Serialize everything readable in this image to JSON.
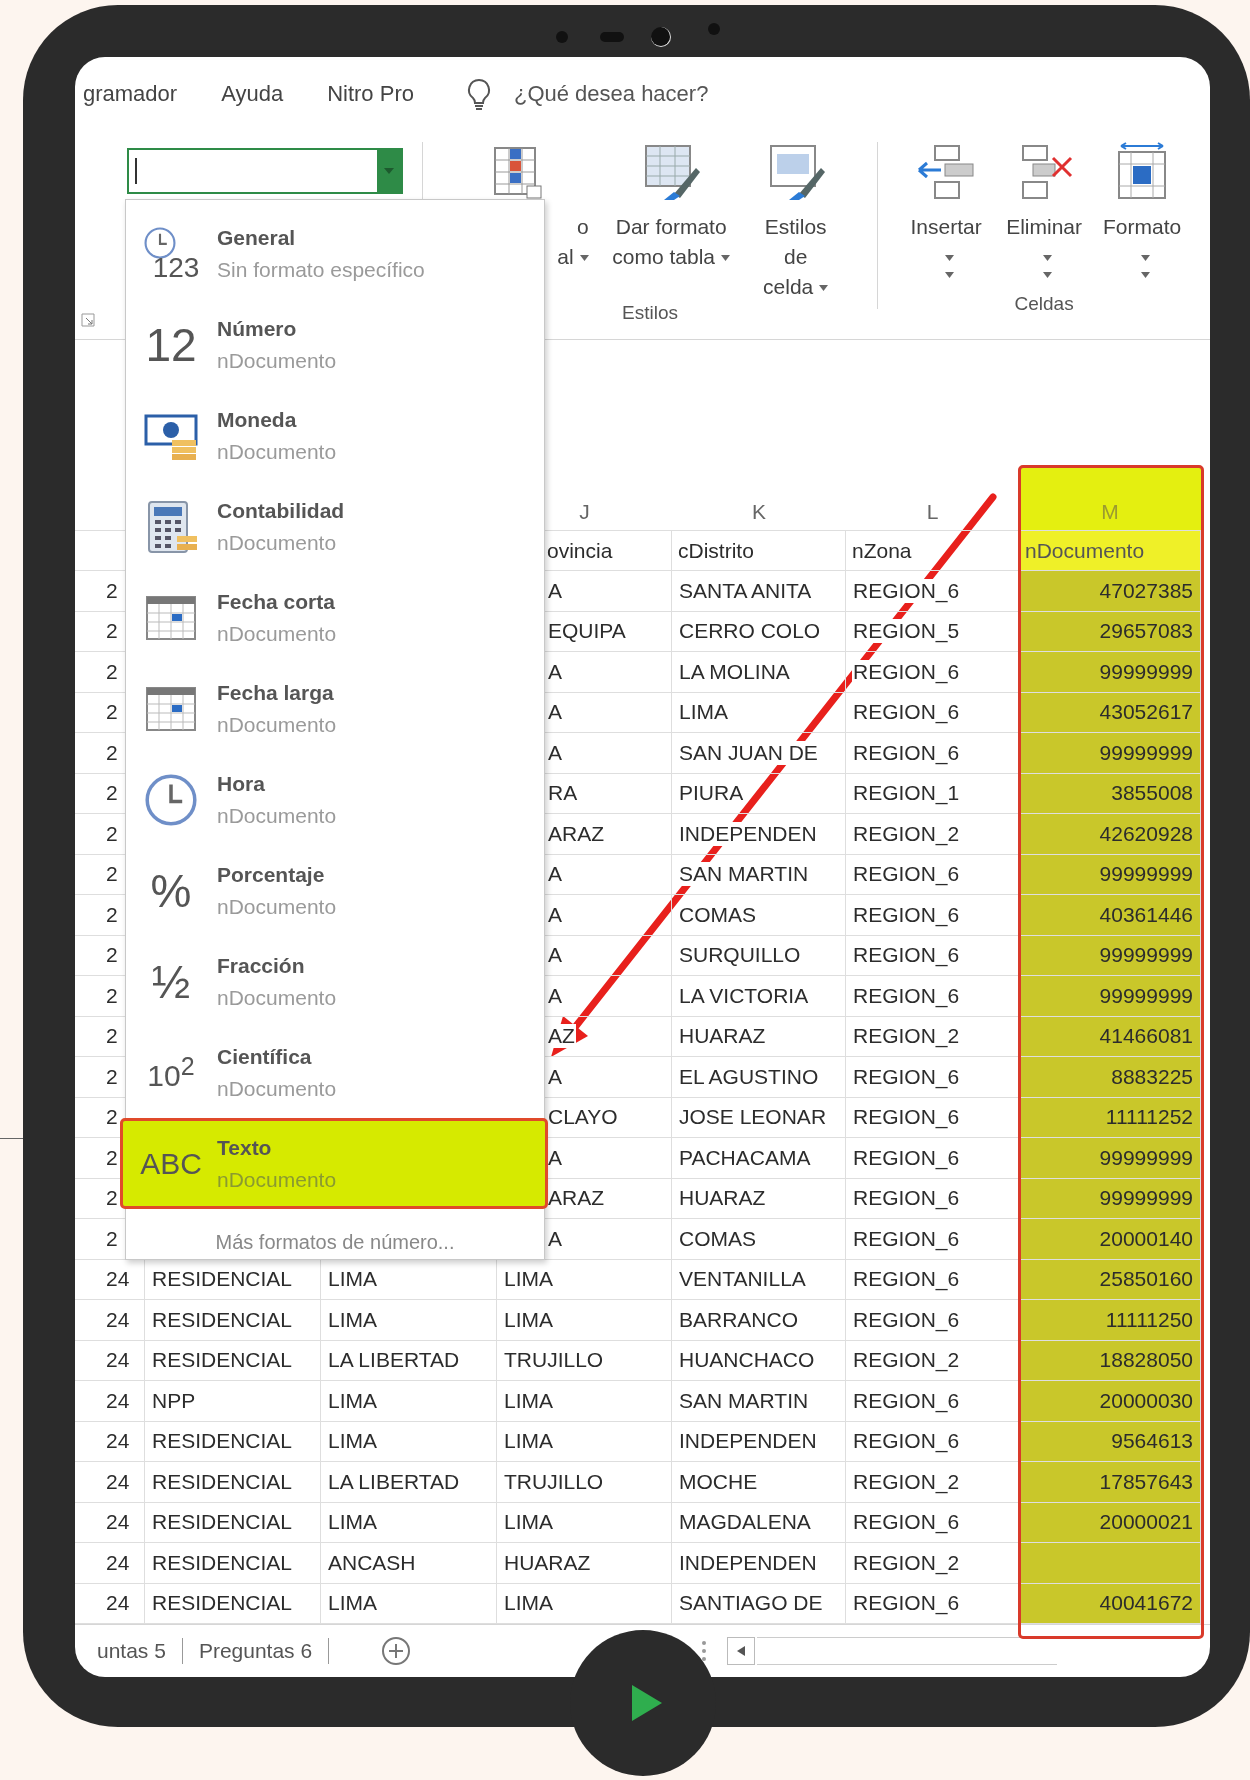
{
  "menu_bar": {
    "items": [
      "gramador",
      "Ayuda",
      "Nitro Pro"
    ],
    "search": {
      "placeholder": "¿Qué desea hacer?"
    }
  },
  "ribbon": {
    "number_format_box": {
      "expanded": true
    },
    "groups": [
      {
        "label": "Estilos",
        "buttons": [
          {
            "kind": "conditional",
            "lines": [
              "o",
              "al"
            ],
            "menu": true
          },
          {
            "kind": "table",
            "lines": [
              "Dar formato",
              "como tabla"
            ],
            "menu": true
          },
          {
            "kind": "cellstyle",
            "lines": [
              "Estilos de",
              "celda"
            ],
            "menu": true
          }
        ]
      },
      {
        "label": "Celdas",
        "buttons": [
          {
            "kind": "insert",
            "lines": [
              "Insertar"
            ],
            "menu": true
          },
          {
            "kind": "delete",
            "lines": [
              "Eliminar"
            ],
            "menu": true
          },
          {
            "kind": "format",
            "lines": [
              "Formato"
            ],
            "menu": true
          }
        ]
      }
    ]
  },
  "number_formats": {
    "items": [
      {
        "title": "General",
        "subtitle": "Sin formato específico",
        "icon": {
          "kind": "clock",
          "glyph": "123"
        },
        "selected": false
      },
      {
        "title": "Número",
        "subtitle": "nDocumento",
        "icon": {
          "kind": "glyph",
          "glyph": "12"
        },
        "selected": false
      },
      {
        "title": "Moneda",
        "subtitle": "nDocumento",
        "icon": {
          "kind": "money"
        },
        "selected": false
      },
      {
        "title": "Contabilidad",
        "subtitle": "nDocumento",
        "icon": {
          "kind": "calculator"
        },
        "selected": false
      },
      {
        "title": "Fecha corta",
        "subtitle": "nDocumento",
        "icon": {
          "kind": "calendar"
        },
        "selected": false
      },
      {
        "title": "Fecha larga",
        "subtitle": "nDocumento",
        "icon": {
          "kind": "calendar"
        },
        "selected": false
      },
      {
        "title": "Hora",
        "subtitle": "nDocumento",
        "icon": {
          "kind": "clock"
        },
        "selected": false
      },
      {
        "title": "Porcentaje",
        "subtitle": "nDocumento",
        "icon": {
          "kind": "glyph",
          "glyph": "%"
        },
        "selected": false
      },
      {
        "title": "Fracción",
        "subtitle": "nDocumento",
        "icon": {
          "kind": "glyph",
          "glyph": "½"
        },
        "selected": false
      },
      {
        "title": "Científica",
        "subtitle": "nDocumento",
        "icon": {
          "kind": "glyph",
          "glyph": "10$^{2}$"
        },
        "selected": false
      },
      {
        "title": "Texto",
        "subtitle": "nDocumento",
        "icon": {
          "kind": "glyph",
          "glyph": "ABC"
        },
        "selected": true
      }
    ],
    "more_link": "Más formatos de número..."
  },
  "sheet": {
    "columns": [
      {
        "letter": "J",
        "name": "ovincia",
        "selected": false
      },
      {
        "letter": "K",
        "name": "cDistrito",
        "selected": false
      },
      {
        "letter": "L",
        "name": "nZona",
        "selected": false
      },
      {
        "letter": "M",
        "name": "nDocumento",
        "selected": true
      }
    ],
    "rows": [
      {
        "column_1": "2",
        "j": "A",
        "k": "SANTA ANITA",
        "l": "REGION_6",
        "m": "47027385"
      },
      {
        "column_1": "2",
        "j": "EQUIPA",
        "k": "CERRO COLO",
        "l": "REGION_5",
        "m": "29657083"
      },
      {
        "column_1": "2",
        "j": "A",
        "k": "LA MOLINA",
        "l": "REGION_6",
        "m": "99999999"
      },
      {
        "column_1": "2",
        "j": "A",
        "k": "LIMA",
        "l": "REGION_6",
        "m": "43052617"
      },
      {
        "column_1": "2",
        "j": "A",
        "k": "SAN JUAN DE",
        "l": "REGION_6",
        "m": "99999999"
      },
      {
        "column_1": "2",
        "j": "RA",
        "k": "PIURA",
        "l": "REGION_1",
        "m": "3855008"
      },
      {
        "column_1": "2",
        "j": "ARAZ",
        "k": "INDEPENDEN",
        "l": "REGION_2",
        "m": "42620928"
      },
      {
        "column_1": "2",
        "j": "A",
        "k": "SAN MARTIN",
        "l": "REGION_6",
        "m": "99999999"
      },
      {
        "column_1": "2",
        "j": "A",
        "k": "COMAS",
        "l": "REGION_6",
        "m": "40361446"
      },
      {
        "column_1": "2",
        "j": "A",
        "k": "SURQUILLO",
        "l": "REGION_6",
        "m": "99999999"
      },
      {
        "column_1": "2",
        "j": "A",
        "k": "LA VICTORIA",
        "l": "REGION_6",
        "m": "99999999"
      },
      {
        "column_1": "2",
        "j": "AZ",
        "k": "HUARAZ",
        "l": "REGION_2",
        "m": "41466081"
      },
      {
        "column_1": "2",
        "j": "A",
        "k": "EL AGUSTINO",
        "l": "REGION_6",
        "m": "8883225"
      },
      {
        "column_1": "2",
        "j": "CLAYO",
        "k": "JOSE LEONAR",
        "l": "REGION_6",
        "m": "11111252"
      },
      {
        "column_1": "2",
        "j": "A",
        "k": "PACHACAMA",
        "l": "REGION_6",
        "m": "99999999"
      },
      {
        "column_1": "2",
        "j": "ARAZ",
        "k": "HUARAZ",
        "l": "REGION_6",
        "m": "99999999"
      },
      {
        "column_1": "2",
        "j": "A",
        "k": "COMAS",
        "l": "REGION_6",
        "m": "20000140"
      },
      {
        "column_1": "24",
        "column_2": "RESIDENCIAL",
        "column_3": "LIMA",
        "j": "LIMA",
        "k": "VENTANILLA",
        "l": "REGION_6",
        "m": "25850160"
      },
      {
        "column_1": "24",
        "column_2": "RESIDENCIAL",
        "column_3": "LIMA",
        "j": "LIMA",
        "k": "BARRANCO",
        "l": "REGION_6",
        "m": "11111250"
      },
      {
        "column_1": "24",
        "column_2": "RESIDENCIAL",
        "column_3": "LA LIBERTAD",
        "j": "TRUJILLO",
        "k": "HUANCHACO",
        "l": "REGION_2",
        "m": "18828050"
      },
      {
        "column_1": "24",
        "column_2": "NPP",
        "column_3": "LIMA",
        "j": "LIMA",
        "k": "SAN MARTIN",
        "l": "REGION_6",
        "m": "20000030"
      },
      {
        "column_1": "24",
        "column_2": "RESIDENCIAL",
        "column_3": "LIMA",
        "j": "LIMA",
        "k": "INDEPENDEN",
        "l": "REGION_6",
        "m": "9564613"
      },
      {
        "column_1": "24",
        "column_2": "RESIDENCIAL",
        "column_3": "LA LIBERTAD",
        "j": "TRUJILLO",
        "k": "MOCHE",
        "l": "REGION_2",
        "m": "17857643"
      },
      {
        "column_1": "24",
        "column_2": "RESIDENCIAL",
        "column_3": "LIMA",
        "j": "LIMA",
        "k": "MAGDALENA",
        "l": "REGION_6",
        "m": "20000021"
      },
      {
        "column_1": "24",
        "column_2": "RESIDENCIAL",
        "column_3": "ANCASH",
        "j": "HUARAZ",
        "k": "INDEPENDEN",
        "l": "REGION_2"
      },
      {
        "column_1": "24",
        "column_2": "RESIDENCIAL",
        "column_3": "LIMA",
        "j": "LIMA",
        "k": "SANTIAGO DE",
        "l": "REGION_6",
        "m": "40041672"
      }
    ]
  },
  "sheet_tabs": [
    {
      "label": "untas 5",
      "selected": false
    },
    {
      "label": "Preguntas 6",
      "selected": false
    }
  ]
}
